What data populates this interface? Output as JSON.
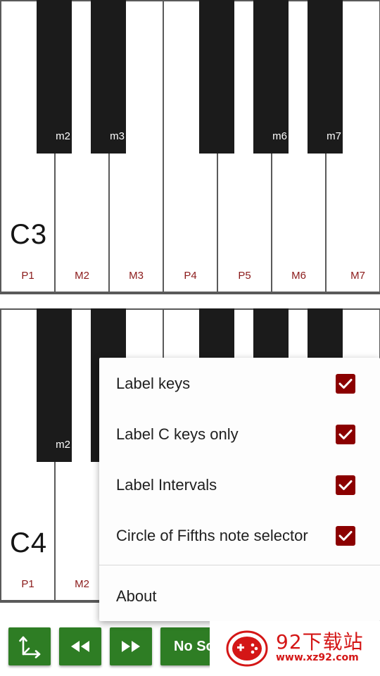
{
  "keyboards": [
    {
      "octave_label": "C3",
      "white_labels": [
        "P1",
        "M2",
        "M3",
        "P4",
        "P5",
        "M6",
        "M7"
      ],
      "black_labels": [
        "m2",
        "m3",
        "",
        "m6",
        "m7"
      ]
    },
    {
      "octave_label": "C4",
      "white_labels": [
        "P1",
        "M2"
      ],
      "black_labels": [
        "m2"
      ]
    }
  ],
  "menu": {
    "items": [
      {
        "label": "Label keys",
        "checked": true
      },
      {
        "label": "Label C keys only",
        "checked": true
      },
      {
        "label": "Label Intervals",
        "checked": true
      },
      {
        "label": "Circle of Fifths note selector",
        "checked": true
      }
    ],
    "about_label": "About"
  },
  "toolbar": {
    "axes_icon": "axes-icon",
    "rewind_icon": "rewind-icon",
    "fast_forward_icon": "fast-forward-icon",
    "sound_label": "No So"
  },
  "watermark": {
    "title": "92下载站",
    "url": "www.xz92.com"
  },
  "colors": {
    "accent_green": "#2e7d24",
    "checkbox_red": "#8b0000",
    "interval_label": "#8b1a1a"
  }
}
